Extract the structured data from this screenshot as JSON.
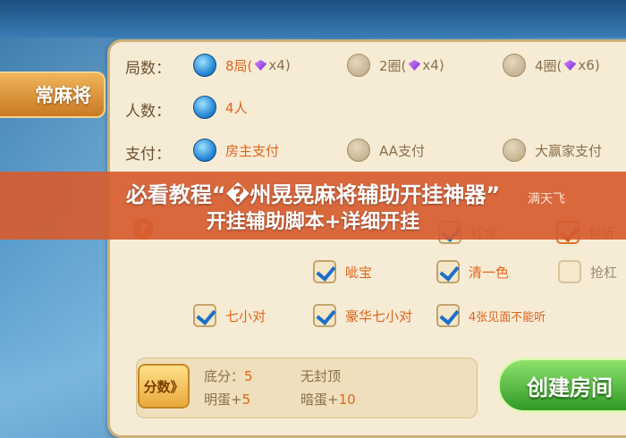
{
  "mode_tab": {
    "label": "常麻将"
  },
  "rows": {
    "rounds": {
      "label": "局数：",
      "options": [
        {
          "label": "8局(",
          "gem_count": "x4)",
          "selected": true
        },
        {
          "label": "2圈(",
          "gem_count": "x4)",
          "selected": false
        },
        {
          "label": "4圈(",
          "gem_count": "x6)",
          "selected": false
        }
      ]
    },
    "players": {
      "label": "人数：",
      "options": [
        {
          "label": "4人",
          "selected": true
        }
      ]
    },
    "payment": {
      "label": "支付：",
      "options": [
        {
          "label": "房主支付",
          "selected": true
        },
        {
          "label": "AA支付",
          "selected": false
        },
        {
          "label": "大赢家支付",
          "selected": false
        }
      ]
    }
  },
  "rules_partial": {
    "row1_right": "满天飞",
    "row2": [
      {
        "label": "杠宝",
        "checked": true
      },
      {
        "label": "包折",
        "checked": true
      }
    ],
    "row3": [
      {
        "label": "呲宝",
        "checked": true
      },
      {
        "label": "清一色",
        "checked": true
      },
      {
        "label": "抢杠",
        "checked": false
      }
    ],
    "row4": [
      {
        "label": "七小对",
        "checked": true
      },
      {
        "label": "豪华七小对",
        "checked": true
      },
      {
        "label": "4张见面不能听",
        "checked": true
      }
    ]
  },
  "banner": {
    "line1": "必看教程“�州晃晃麻将辅助开挂神器”",
    "line2": "开挂辅助脚本+详细开挂"
  },
  "score": {
    "button_label": "分数》",
    "base_label": "底分：",
    "base_value": "5",
    "cap_label": "无封顶",
    "open_label": "明蛋+",
    "open_value": "5",
    "hidden_label": "暗蛋+",
    "hidden_value": "10"
  },
  "create_button": {
    "label": "创建房间"
  },
  "colors": {
    "accent": "#e0641c",
    "selected_radio": "#2a8ad6",
    "banner": "#d65c30",
    "create_green": "#2f9a25"
  }
}
